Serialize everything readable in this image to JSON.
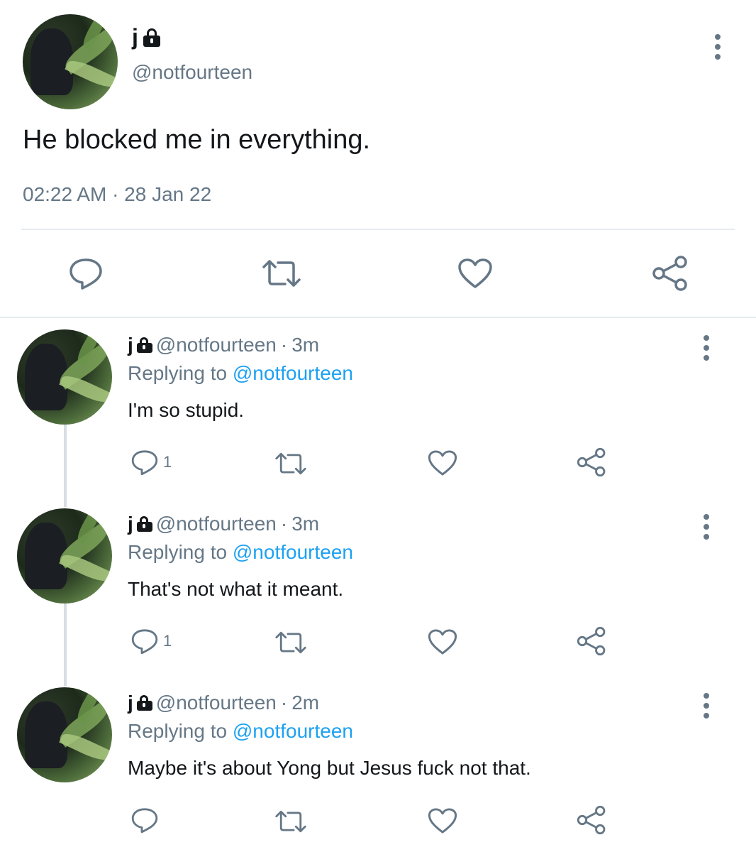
{
  "main_tweet": {
    "name": "j",
    "handle": "@notfourteen",
    "text": "He blocked me in everything.",
    "timestamp": "02:22 AM · 28 Jan 22"
  },
  "replies": [
    {
      "name": "j",
      "handle": "@notfourteen",
      "separator": "·",
      "time": "3m",
      "replying_prefix": "Replying to",
      "replying_to": "@notfourteen",
      "text": "I'm so stupid.",
      "reply_count": "1"
    },
    {
      "name": "j",
      "handle": "@notfourteen",
      "separator": "·",
      "time": "3m",
      "replying_prefix": "Replying to",
      "replying_to": "@notfourteen",
      "text": "That's not what it meant.",
      "reply_count": "1"
    },
    {
      "name": "j",
      "handle": "@notfourteen",
      "separator": "·",
      "time": "2m",
      "replying_prefix": "Replying to",
      "replying_to": "@notfourteen",
      "text": "Maybe it's about Yong but Jesus fuck not that.",
      "reply_count": ""
    }
  ],
  "icons": {
    "reply": "speech-bubble-icon",
    "retweet": "retweet-icon",
    "like": "heart-icon",
    "share": "share-icon",
    "more": "more-vertical-icon",
    "lock": "lock-icon"
  },
  "colors": {
    "text": "#14171a",
    "secondary": "#657786",
    "link": "#1da1f2",
    "divider": "#e6ecf0"
  }
}
